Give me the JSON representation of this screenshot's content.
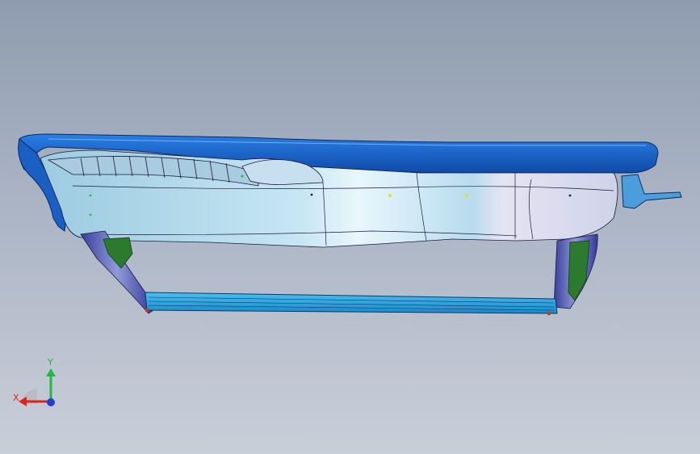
{
  "viewport": {
    "background_top": "#8f9cb0",
    "background_bottom": "#c9cfd9"
  },
  "model": {
    "icon": "car-door-assembly-3d-model",
    "colors": {
      "shell": "#1f6fd6",
      "shell_dark": "#0d3f8a",
      "panel": "#a9d7ea",
      "panel_light": "#e8f4fb",
      "rail": "#2aa7e6",
      "bracket": "#2c7a2e",
      "edge": "#1b1b3a"
    }
  },
  "triad": {
    "x_label": "X",
    "y_label": "Y",
    "x_color": "#e0201c",
    "y_color": "#23b845",
    "z_color": "#2240d8"
  }
}
